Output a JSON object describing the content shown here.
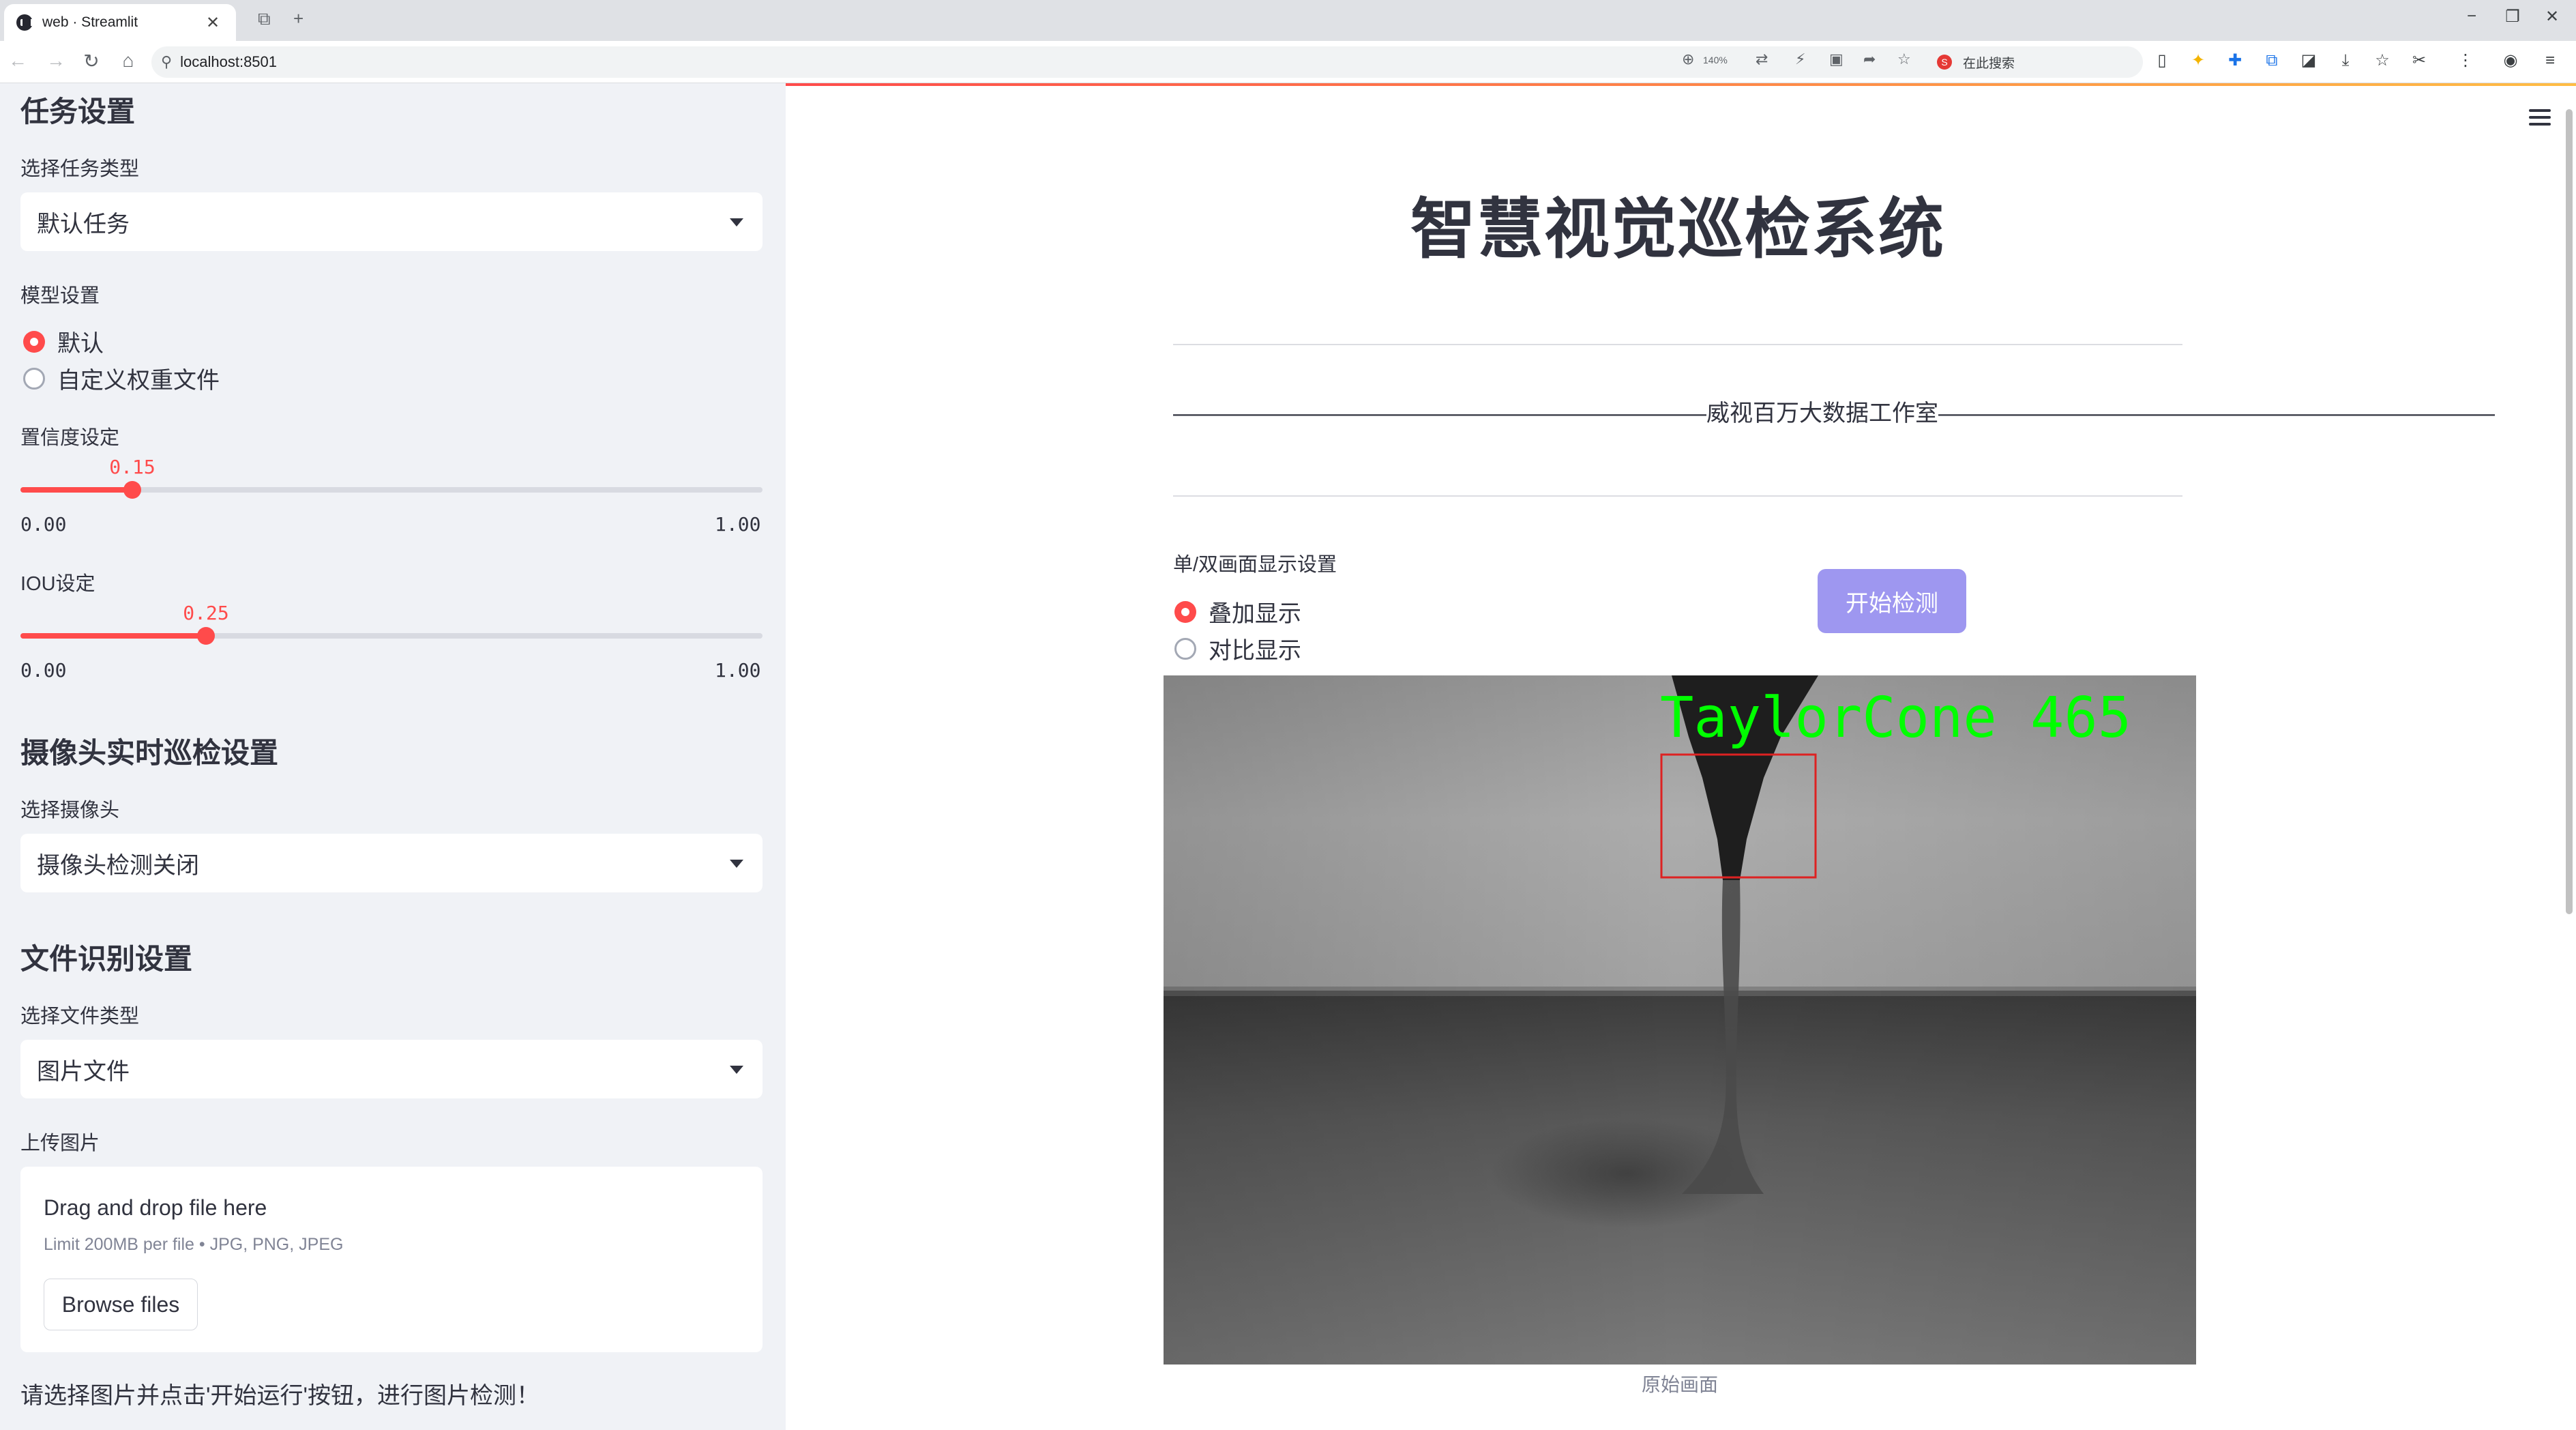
{
  "browser": {
    "tab_title": "web · Streamlit",
    "tab_close": "✕",
    "url": "localhost:8501",
    "zoom": "140%",
    "search_placeholder": "在此搜索",
    "search_logo": "S"
  },
  "sidebar": {
    "task_section_title": "任务设置",
    "task_type_label": "选择任务类型",
    "task_type_value": "默认任务",
    "model_label": "模型设置",
    "model_options": [
      "默认",
      "自定义权重文件"
    ],
    "model_selected_index": 0,
    "confidence_label": "置信度设定",
    "confidence": {
      "value": 0.15,
      "display": "0.15",
      "min": "0.00",
      "max": "1.00"
    },
    "iou_label": "IOU设定",
    "iou": {
      "value": 0.25,
      "display": "0.25",
      "min": "0.00",
      "max": "1.00"
    },
    "camera_section_title": "摄像头实时巡检设置",
    "camera_label": "选择摄像头",
    "camera_value": "摄像头检测关闭",
    "file_section_title": "文件识别设置",
    "file_type_label": "选择文件类型",
    "file_type_value": "图片文件",
    "upload_label": "上传图片",
    "upload_title": "Drag and drop file here",
    "upload_limit": "Limit 200MB per file • JPG, PNG, JPEG",
    "browse_button": "Browse files",
    "hint": "请选择图片并点击'开始运行'按钮，进行图片检测！"
  },
  "main": {
    "title": "智慧视觉巡检系统",
    "studio_line": "———————————————————————威视百万大数据工作室————————————————————————",
    "display_label": "单/双画面显示设置",
    "display_options": [
      "叠加显示",
      "对比显示"
    ],
    "display_selected_index": 0,
    "start_button": "开始检测",
    "detection_label": "TaylorCone 465",
    "image_caption": "原始画面"
  },
  "colors": {
    "accent": "#ff4b4b",
    "start_button": "#9e97f0",
    "sidebar_bg": "#f0f2f6",
    "detection_text": "#00ff00",
    "detection_box": "#dd2222"
  }
}
